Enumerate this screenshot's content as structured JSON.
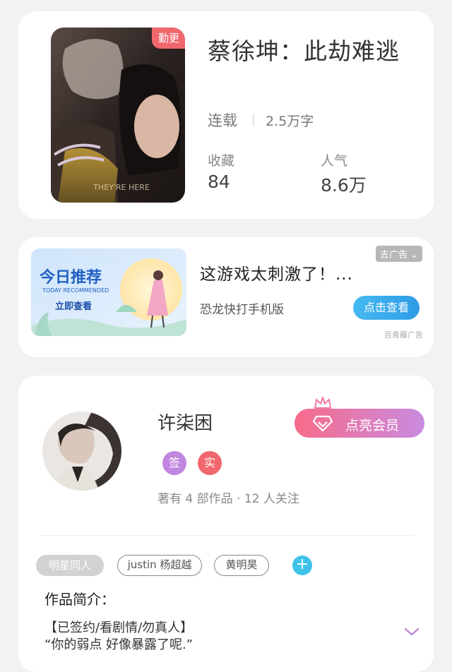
{
  "book": {
    "cover_badge": "勤更",
    "title": "蔡徐坤：此劫难逃",
    "status": "连载",
    "word_count": "2.5万字",
    "favorites_label": "收藏",
    "favorites_value": "84",
    "popularity_label": "人气",
    "popularity_value": "8.6万"
  },
  "ad": {
    "image_title": "今日推荐",
    "image_subtitle": "TODAY RECOMMENDED",
    "image_button": "立即查看",
    "title": "这游戏太刺激了！...",
    "subtitle": "恐龙快打手机版",
    "cta": "点击查看",
    "remove_label": "去广告 ⌄",
    "source": "百青藤广告"
  },
  "author": {
    "name": "许柒困",
    "badge_sign": "签",
    "badge_real": "实",
    "stats": "著有 4 部作品 · 12 人关注",
    "vip_button": "点亮会员",
    "tags": [
      "明星同人",
      "justin 杨超越",
      "黄明昊"
    ],
    "intro_title": "作品简介：",
    "intro_lines": [
      "【已签约/看剧情/勿真人】",
      "“你的弱点 好像暴露了呢.”"
    ]
  },
  "colors": {
    "background": "#f2f2f2",
    "badge_red": "#f0676e",
    "badge_purple": "#c187e0",
    "cta_blue": "#2f9ce6",
    "vip_gradient_start": "#f76b8a",
    "vip_gradient_end": "#c98be0",
    "tag_add": "#3ec2ea"
  },
  "icons": [
    "diamond-icon",
    "crown-icon",
    "plus-icon",
    "chevron-down-icon"
  ]
}
